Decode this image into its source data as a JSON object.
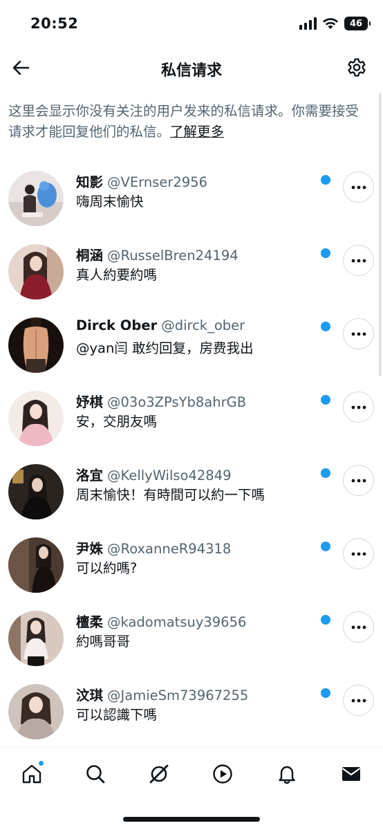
{
  "status_bar": {
    "time": "20:52",
    "battery": "46",
    "icons": [
      "signal-icon",
      "wifi-icon",
      "battery-icon"
    ]
  },
  "header": {
    "title": "私信请求",
    "back_icon": "arrow-left-icon",
    "settings_icon": "gear-icon"
  },
  "info": {
    "text": "这里会显示你没有关注的用户发来的私信请求。你需要接受请求才能回复他们的私信。",
    "link": "了解更多"
  },
  "requests": [
    {
      "name": "知影",
      "handle": "@VErnser2956",
      "message": "嗨周末愉快",
      "unread": true
    },
    {
      "name": "桐涵",
      "handle": "@RusselBren24194",
      "message": "真人約要約嗎",
      "unread": true
    },
    {
      "name": "Dirck Ober",
      "handle": "@dirck_ober",
      "message": "@yan闫 敢约回复，房费我出",
      "unread": true
    },
    {
      "name": "妤棋",
      "handle": "@03o3ZPsYb8ahrGB",
      "message": "安，交朋友嗎",
      "unread": true
    },
    {
      "name": "洛宜",
      "handle": "@KellyWilso42849",
      "message": "周末愉快！有時間可以約一下嗎",
      "unread": true
    },
    {
      "name": "尹姝",
      "handle": "@RoxanneR94318",
      "message": "可以約嗎?",
      "unread": true
    },
    {
      "name": "檀柔",
      "handle": "@kadomatsuy39656",
      "message": "約嗎哥哥",
      "unread": true
    },
    {
      "name": "汶琪",
      "handle": "@JamieSm73967255",
      "message": "可以認識下嗎",
      "unread": true
    }
  ],
  "bottom_nav": [
    {
      "icon": "home-icon",
      "badge": true
    },
    {
      "icon": "search-icon",
      "badge": false
    },
    {
      "icon": "grok-icon",
      "badge": false
    },
    {
      "icon": "play-icon",
      "badge": false
    },
    {
      "icon": "bell-icon",
      "badge": false
    },
    {
      "icon": "mail-icon",
      "badge": false
    }
  ],
  "colors": {
    "accent": "#1d9bf0",
    "text_primary": "#0f1419",
    "text_secondary": "#536471"
  }
}
